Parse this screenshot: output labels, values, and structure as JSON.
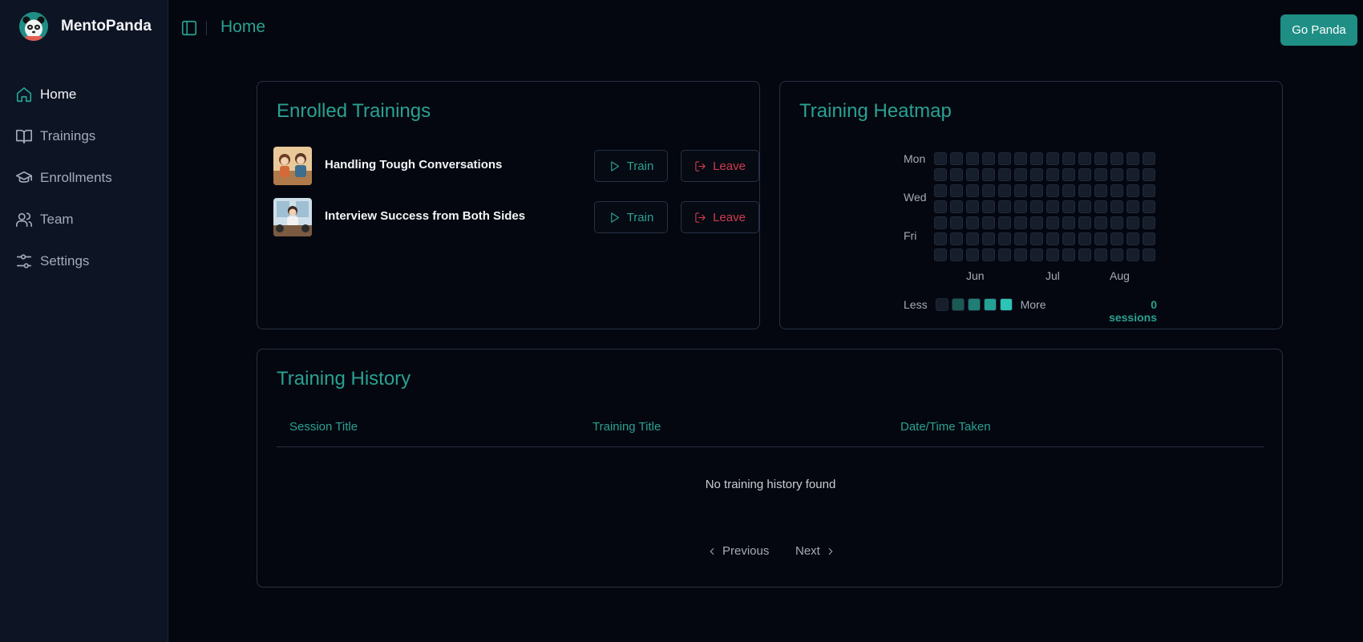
{
  "app": {
    "name": "MentoPanda"
  },
  "colors": {
    "accent": "#2aa192",
    "danger": "#d13b4f",
    "background": "#04070f",
    "sidebar": "#0d1424"
  },
  "sidebar": {
    "items": [
      {
        "label": "Home",
        "icon": "home-icon",
        "active": true
      },
      {
        "label": "Trainings",
        "icon": "book-icon",
        "active": false
      },
      {
        "label": "Enrollments",
        "icon": "graduation-cap-icon",
        "active": false
      },
      {
        "label": "Team",
        "icon": "users-icon",
        "active": false
      },
      {
        "label": "Settings",
        "icon": "sliders-icon",
        "active": false
      }
    ]
  },
  "header": {
    "title": "Home",
    "cta_label": "Go Panda"
  },
  "enrolled": {
    "title": "Enrolled Trainings",
    "train_label": "Train",
    "leave_label": "Leave",
    "items": [
      {
        "title": "Handling Tough Conversations"
      },
      {
        "title": "Interview Success from Both Sides"
      }
    ]
  },
  "heatmap": {
    "title": "Training Heatmap",
    "days": [
      "Mon",
      "Wed",
      "Fri"
    ],
    "months": [
      "Jun",
      "Jul",
      "Aug"
    ],
    "legend_less": "Less",
    "legend_more": "More",
    "legend_colors": [
      "#161e2c",
      "#1a5a55",
      "#1f7f77",
      "#24a195",
      "#2cc4b4"
    ],
    "sessions_label": "0 sessions",
    "week_count": 14,
    "values": []
  },
  "history": {
    "title": "Training History",
    "columns": [
      "Session Title",
      "Training Title",
      "Date/Time Taken"
    ],
    "rows": [],
    "empty_text": "No training history found",
    "previous_label": "Previous",
    "next_label": "Next"
  }
}
